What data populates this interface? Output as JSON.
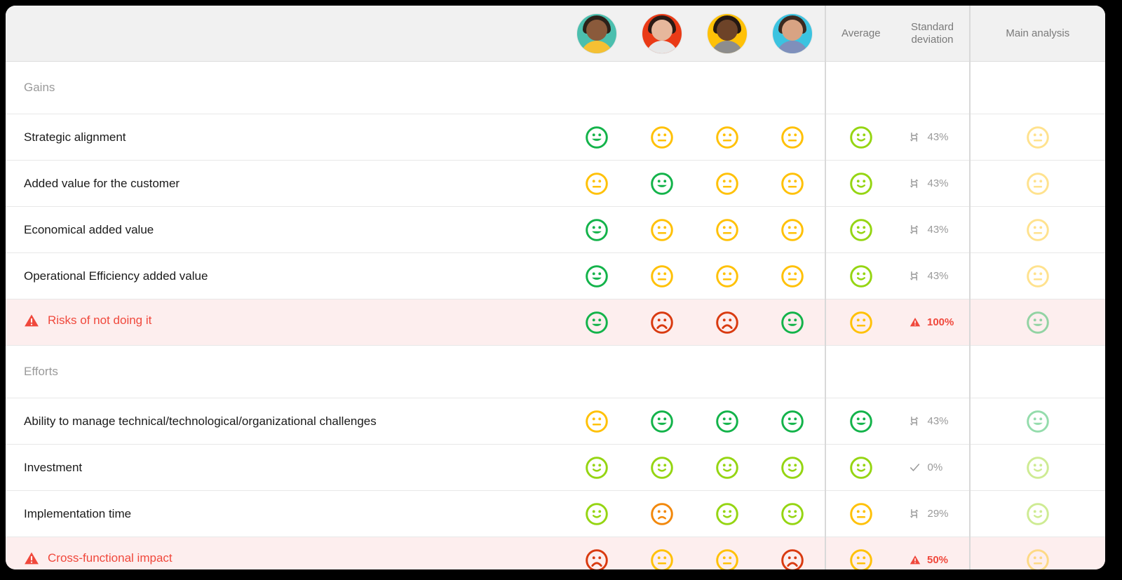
{
  "header": {
    "label_col": "",
    "average": "Average",
    "standard_deviation_line1": "Standard",
    "standard_deviation_line2": "deviation",
    "main_analysis": "Main analysis",
    "participants": [
      {
        "name": "participant-1",
        "bg": "#4bbfae",
        "hair": "#2b2119",
        "skin": "#8a5a3b",
        "body": "#f5c033"
      },
      {
        "name": "participant-2",
        "bg": "#ea3a16",
        "hair": "#2a1b16",
        "skin": "#e6b79c",
        "body": "#e7e7e7"
      },
      {
        "name": "participant-3",
        "bg": "#ffc107",
        "hair": "#241812",
        "skin": "#6d4328",
        "body": "#8d8d8d"
      },
      {
        "name": "participant-4",
        "bg": "#3bc3e0",
        "hair": "#3b2a20",
        "skin": "#d8a383",
        "body": "#7f8fbb"
      }
    ]
  },
  "colors": {
    "green": "#13b34a",
    "lime": "#95d512",
    "yellow": "#ffc107",
    "orange": "#f2880b",
    "red": "#d93a10",
    "alert": "#f0483c",
    "grey": "#9a9a9a",
    "risk_row_bg": "#fdeeee",
    "header_bg": "#f1f1f1"
  },
  "sections": [
    {
      "title": "Gains",
      "rows": [
        {
          "label": "Strategic alignment",
          "risk": false,
          "ratings": [
            "happy-green",
            "neutral-yellow",
            "neutral-yellow",
            "neutral-yellow"
          ],
          "average": "slight-lime",
          "sd_icon": "arrows-icon",
          "sd_value": "43%",
          "sd_alert": false,
          "main": "neutral-yellow"
        },
        {
          "label": "Added value for the customer",
          "risk": false,
          "ratings": [
            "neutral-yellow",
            "happy-green",
            "neutral-yellow",
            "neutral-yellow"
          ],
          "average": "slight-lime",
          "sd_icon": "arrows-icon",
          "sd_value": "43%",
          "sd_alert": false,
          "main": "neutral-yellow"
        },
        {
          "label": "Economical added value",
          "risk": false,
          "ratings": [
            "happy-green",
            "neutral-yellow",
            "neutral-yellow",
            "neutral-yellow"
          ],
          "average": "slight-lime",
          "sd_icon": "arrows-icon",
          "sd_value": "43%",
          "sd_alert": false,
          "main": "neutral-yellow"
        },
        {
          "label": "Operational Efficiency added value",
          "risk": false,
          "ratings": [
            "happy-green",
            "neutral-yellow",
            "neutral-yellow",
            "neutral-yellow"
          ],
          "average": "slight-lime",
          "sd_icon": "arrows-icon",
          "sd_value": "43%",
          "sd_alert": false,
          "main": "neutral-yellow"
        },
        {
          "label": "Risks of not doing it",
          "risk": true,
          "ratings": [
            "happy-green",
            "sad-red",
            "sad-red",
            "happy-green"
          ],
          "average": "neutral-yellow",
          "sd_icon": "warning-icon",
          "sd_value": "100%",
          "sd_alert": true,
          "main": "happy-green"
        }
      ]
    },
    {
      "title": "Efforts",
      "rows": [
        {
          "label": "Ability to manage technical/technological/organizational challenges",
          "risk": false,
          "ratings": [
            "neutral-yellow",
            "happy-green",
            "happy-green",
            "happy-green"
          ],
          "average": "happy-green",
          "sd_icon": "arrows-icon",
          "sd_value": "43%",
          "sd_alert": false,
          "main": "happy-green"
        },
        {
          "label": "Investment",
          "risk": false,
          "ratings": [
            "slight-lime",
            "slight-lime",
            "slight-lime",
            "slight-lime"
          ],
          "average": "slight-lime",
          "sd_icon": "check-icon",
          "sd_value": "0%",
          "sd_alert": false,
          "main": "slight-lime"
        },
        {
          "label": "Implementation time",
          "risk": false,
          "ratings": [
            "slight-lime",
            "frown-orange",
            "slight-lime",
            "slight-lime"
          ],
          "average": "neutral-yellow",
          "sd_icon": "arrows-icon",
          "sd_value": "29%",
          "sd_alert": false,
          "main": "slight-lime"
        },
        {
          "label": "Cross-functional impact",
          "risk": true,
          "ratings": [
            "sad-red",
            "neutral-yellow",
            "neutral-yellow",
            "sad-red"
          ],
          "average": "neutral-yellow",
          "sd_icon": "warning-icon",
          "sd_value": "50%",
          "sd_alert": true,
          "main": "neutral-yellow"
        }
      ]
    }
  ]
}
